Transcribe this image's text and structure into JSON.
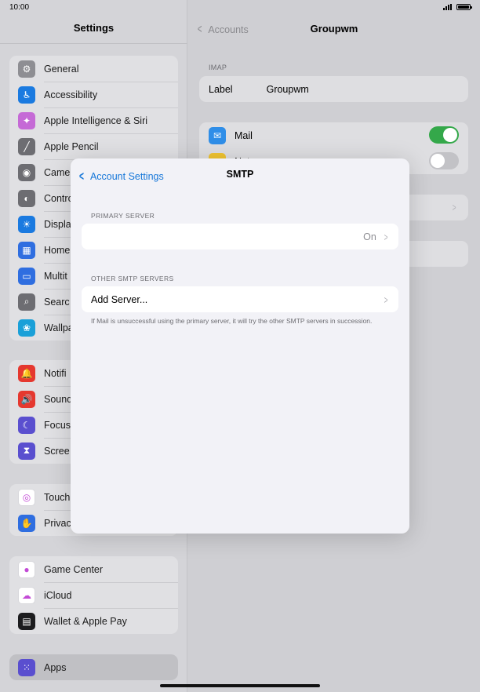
{
  "status": {
    "time": "10:00"
  },
  "sidebar": {
    "title": "Settings",
    "group1": [
      {
        "label": "General",
        "icon": "gear-icon",
        "color": "#8e8e93",
        "glyph": "⚙"
      },
      {
        "label": "Accessibility",
        "icon": "accessibility-icon",
        "color": "#1a7ae0",
        "glyph": "♿"
      },
      {
        "label": "Apple Intelligence & Siri",
        "icon": "siri-icon",
        "color": "#c56ad6",
        "glyph": "✦"
      },
      {
        "label": "Apple Pencil",
        "icon": "pencil-icon",
        "color": "#6d6d72",
        "glyph": "╱"
      },
      {
        "label": "Came",
        "icon": "camera-icon",
        "color": "#6d6d72",
        "glyph": "◉"
      },
      {
        "label": "Contro",
        "icon": "control-center-icon",
        "color": "#6d6d72",
        "glyph": "◐"
      },
      {
        "label": "Displa",
        "icon": "brightness-icon",
        "color": "#1a7ae0",
        "glyph": "☀"
      },
      {
        "label": "Home",
        "icon": "home-screen-icon",
        "color": "#2f6ee0",
        "glyph": "▦"
      },
      {
        "label": "Multit",
        "icon": "multitasking-icon",
        "color": "#2f6ee0",
        "glyph": "▭"
      },
      {
        "label": "Searc",
        "icon": "search-icon",
        "color": "#6d6d72",
        "glyph": "⌕"
      },
      {
        "label": "Wallpa",
        "icon": "wallpaper-icon",
        "color": "#1aa0d8",
        "glyph": "❀"
      }
    ],
    "group2": [
      {
        "label": "Notifi",
        "icon": "notifications-icon",
        "color": "#e5382f",
        "glyph": "🔔"
      },
      {
        "label": "Sound",
        "icon": "sound-icon",
        "color": "#e5382f",
        "glyph": "🔊"
      },
      {
        "label": "Focus",
        "icon": "focus-moon-icon",
        "color": "#5a4fcf",
        "glyph": "☾"
      },
      {
        "label": "Scree",
        "icon": "screen-time-icon",
        "color": "#5a4fcf",
        "glyph": "⧗"
      }
    ],
    "group3": [
      {
        "label": "Touch",
        "icon": "touch-id-icon",
        "color": "#ffffff",
        "glyph": "◎"
      },
      {
        "label": "Privac",
        "icon": "privacy-hand-icon",
        "color": "#2f6ee0",
        "glyph": "✋"
      }
    ],
    "group4": [
      {
        "label": "Game Center",
        "icon": "game-center-icon",
        "color": "#ffffff",
        "glyph": "●"
      },
      {
        "label": "iCloud",
        "icon": "icloud-icon",
        "color": "#ffffff",
        "glyph": "☁"
      },
      {
        "label": "Wallet & Apple Pay",
        "icon": "wallet-icon",
        "color": "#1c1c1e",
        "glyph": "▤"
      }
    ],
    "group5": [
      {
        "label": "Apps",
        "icon": "apps-grid-icon",
        "color": "#5a4fcf",
        "glyph": "⁙"
      }
    ]
  },
  "detail": {
    "back_label": "Accounts",
    "title": "Groupwm",
    "imap_header": "IMAP",
    "label_key": "Label",
    "label_value": "Groupwm",
    "mail_label": "Mail",
    "notes_label": "Not"
  },
  "modal": {
    "back_label": "Account Settings",
    "title": "SMTP",
    "primary_header": "PRIMARY SERVER",
    "primary_value": "On",
    "other_header": "OTHER SMTP SERVERS",
    "add_server": "Add Server...",
    "footnote": "If Mail is unsuccessful using the primary server, it will try the other SMTP servers in succession."
  }
}
